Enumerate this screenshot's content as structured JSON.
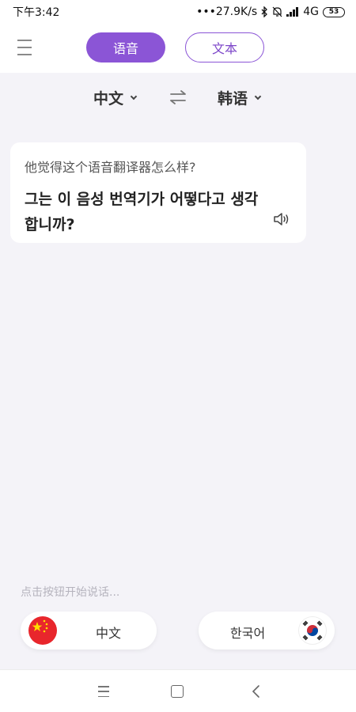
{
  "status": {
    "time": "下午3:42",
    "speed": "27.9K/s",
    "network": "4G",
    "battery": "53"
  },
  "tabs": {
    "voice": "语音",
    "text": "文本"
  },
  "languages": {
    "source": "中文",
    "target": "韩语"
  },
  "translation": {
    "source_text": "他觉得这个语音翻译器怎么样?",
    "target_text": "그는 이 음성 번역기가 어떻다고 생각 합니까?"
  },
  "hint": "点击按钮开始说话...",
  "buttons": {
    "chinese": "中文",
    "korean": "한국어"
  },
  "colors": {
    "accent": "#8b55d6",
    "background": "#f4f3f8"
  }
}
